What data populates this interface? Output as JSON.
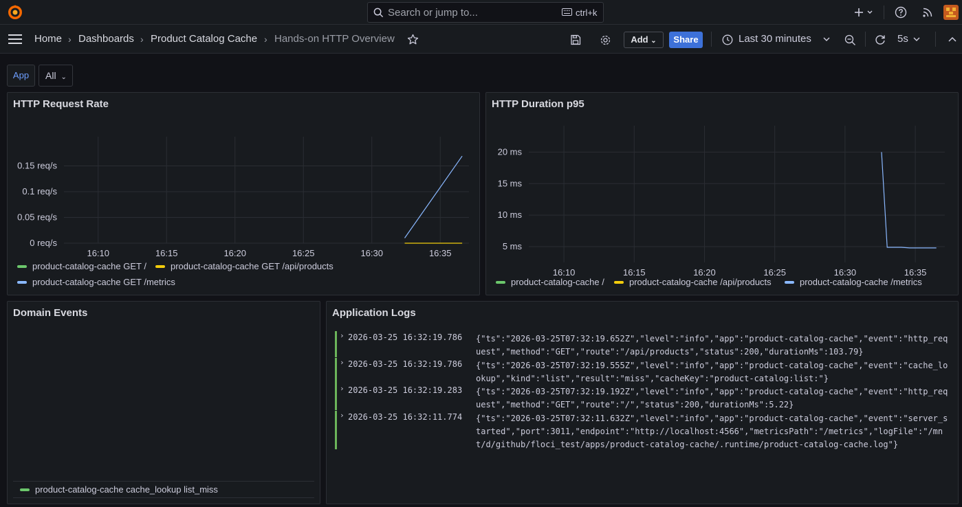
{
  "topbar": {
    "search_placeholder": "Search or jump to...",
    "search_shortcut": "ctrl+k"
  },
  "breadcrumb": {
    "home": "Home",
    "dashboards": "Dashboards",
    "folder": "Product Catalog Cache",
    "dashboard": "Hands-on HTTP Overview"
  },
  "toolbar": {
    "add_label": "Add",
    "share_label": "Share",
    "time_range": "Last 30 minutes",
    "refresh_interval": "5s"
  },
  "variables": {
    "app_label": "App",
    "app_value": "All"
  },
  "colors": {
    "green": "#6cc76c",
    "yellow": "#f2cc0c",
    "blue": "#8ab8ff",
    "accent": "#3d71d9"
  },
  "panels": {
    "request_rate": {
      "title": "HTTP Request Rate",
      "legend": [
        "product-catalog-cache GET /",
        "product-catalog-cache GET /api/products",
        "product-catalog-cache GET /metrics"
      ]
    },
    "duration": {
      "title": "HTTP Duration p95",
      "legend": [
        "product-catalog-cache /",
        "product-catalog-cache /api/products",
        "product-catalog-cache /metrics"
      ]
    },
    "domain_events": {
      "title": "Domain Events",
      "legend": [
        "product-catalog-cache cache_lookup list_miss"
      ]
    },
    "logs": {
      "title": "Application Logs",
      "entries": [
        {
          "ts": "2026-03-25 16:32:19.786",
          "msg": "{\"ts\":\"2026-03-25T07:32:19.652Z\",\"level\":\"info\",\"app\":\"product-catalog-cache\",\"event\":\"http_request\",\"method\":\"GET\",\"route\":\"/api/products\",\"status\":200,\"durationMs\":103.79}"
        },
        {
          "ts": "2026-03-25 16:32:19.786",
          "msg": "{\"ts\":\"2026-03-25T07:32:19.555Z\",\"level\":\"info\",\"app\":\"product-catalog-cache\",\"event\":\"cache_lookup\",\"kind\":\"list\",\"result\":\"miss\",\"cacheKey\":\"product-catalog:list:\"}"
        },
        {
          "ts": "2026-03-25 16:32:19.283",
          "msg": "{\"ts\":\"2026-03-25T07:32:19.192Z\",\"level\":\"info\",\"app\":\"product-catalog-cache\",\"event\":\"http_request\",\"method\":\"GET\",\"route\":\"/\",\"status\":200,\"durationMs\":5.22}"
        },
        {
          "ts": "2026-03-25 16:32:11.774",
          "msg": "{\"ts\":\"2026-03-25T07:32:11.632Z\",\"level\":\"info\",\"app\":\"product-catalog-cache\",\"event\":\"server_started\",\"port\":3011,\"endpoint\":\"http://localhost:4566\",\"metricsPath\":\"/metrics\",\"logFile\":\"/mnt/d/github/floci_test/apps/product-catalog-cache/.runtime/product-catalog-cache.log\"}"
        }
      ]
    }
  },
  "chart_data": [
    {
      "type": "line",
      "title": "HTTP Request Rate",
      "x_ticks": [
        "16:10",
        "16:15",
        "16:20",
        "16:25",
        "16:30",
        "16:35"
      ],
      "y_ticks": [
        "0 req/s",
        "0.05 req/s",
        "0.1 req/s",
        "0.15 req/s"
      ],
      "x_range_min": [
        7.5,
        37.1
      ],
      "ylim": [
        0,
        0.18
      ],
      "grid": true,
      "legend_position": "bottom",
      "series": [
        {
          "name": "product-catalog-cache GET /",
          "color": "#6cc76c",
          "x_min": [],
          "y": []
        },
        {
          "name": "product-catalog-cache GET /api/products",
          "color": "#f2cc0c",
          "x_min": [
            32.4,
            36.6
          ],
          "y": [
            0,
            0
          ]
        },
        {
          "name": "product-catalog-cache GET /metrics",
          "color": "#8ab8ff",
          "x_min": [
            32.4,
            36.6
          ],
          "y": [
            0.01,
            0.169
          ]
        }
      ]
    },
    {
      "type": "line",
      "title": "HTTP Duration p95",
      "x_ticks": [
        "16:10",
        "16:15",
        "16:20",
        "16:25",
        "16:30",
        "16:35"
      ],
      "y_ticks": [
        "5 ms",
        "10 ms",
        "15 ms",
        "20 ms"
      ],
      "x_range_min": [
        7.5,
        37.1
      ],
      "ylim": [
        2.5,
        22
      ],
      "grid": true,
      "legend_position": "bottom",
      "series": [
        {
          "name": "product-catalog-cache /",
          "color": "#6cc76c",
          "x_min": [],
          "y": []
        },
        {
          "name": "product-catalog-cache /api/products",
          "color": "#f2cc0c",
          "x_min": [],
          "y": []
        },
        {
          "name": "product-catalog-cache /metrics",
          "color": "#8ab8ff",
          "x_min": [
            32.6,
            33.0,
            34.0,
            34.6,
            35.4,
            36.5
          ],
          "y": [
            20.0,
            4.9,
            4.9,
            4.8,
            4.8,
            4.8
          ]
        }
      ]
    }
  ]
}
